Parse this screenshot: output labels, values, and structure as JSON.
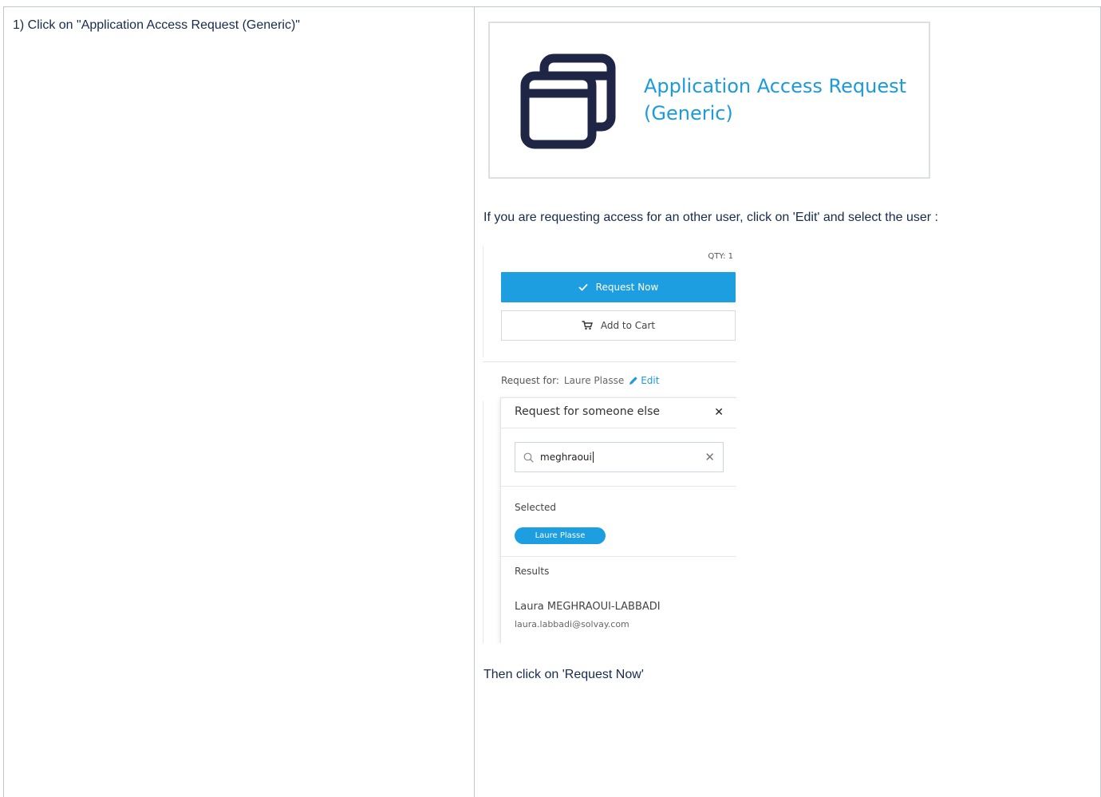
{
  "step1": {
    "instruction": "1) Click on \"Application Access Request (Generic)\""
  },
  "catalog_card": {
    "icon": "application-windows-icon",
    "title": "Application Access Request (Generic)"
  },
  "edit_instruction": "If you are requesting access for an other user, click on 'Edit' and select the user :",
  "request_panel": {
    "qty": "QTY: 1",
    "request_now_label": "Request Now",
    "add_to_cart_label": "Add to Cart",
    "request_for_label": "Request for:",
    "request_for_name": "Laure Plasse",
    "edit_label": "Edit",
    "accent_color": "#1d9ee0"
  },
  "popover": {
    "title": "Request for someone else",
    "close_icon": "close-icon",
    "search_value": "meghraoui",
    "selected_label": "Selected",
    "selected_chip": "Laure Plasse",
    "results_label": "Results",
    "results": [
      {
        "name": "Laura MEGHRAOUI-LABBADI",
        "email": "laura.labbadi@solvay.com"
      }
    ]
  },
  "final_instruction": "Then click on 'Request Now'"
}
